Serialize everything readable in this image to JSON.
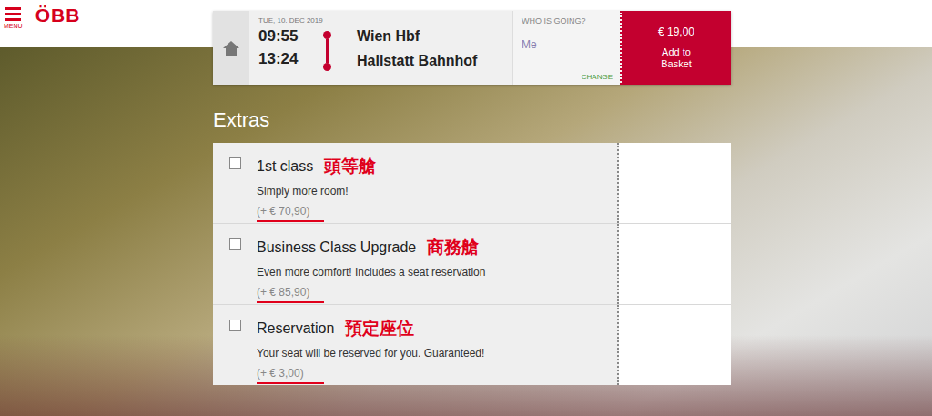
{
  "brand": {
    "menu_label": "MENU",
    "logo": "ÖBB"
  },
  "journey": {
    "date": "TUE, 10. DEC 2019",
    "departure_time": "09:55",
    "arrival_time": "13:24",
    "from": "Wien Hbf",
    "to": "Hallstatt Bahnhof"
  },
  "passengers": {
    "label": "WHO IS GOING?",
    "value": "Me",
    "action": "CHANGE"
  },
  "basket": {
    "price": "€ 19,00",
    "label": "Add to Basket"
  },
  "section_title": "Extras",
  "extras": [
    {
      "title": "1st class",
      "annotation": "頭等艙",
      "description": "Simply more room!",
      "price": "(+ € 70,90)",
      "checked": false
    },
    {
      "title": "Business Class Upgrade",
      "annotation": "商務艙",
      "description": "Even more comfort! Includes a seat reservation",
      "price": "(+ € 85,90)",
      "checked": false
    },
    {
      "title": "Reservation",
      "annotation": "預定座位",
      "description": "Your seat will be reserved for you. Guaranteed!",
      "price": "(+ € 3,00)",
      "checked": false
    }
  ]
}
